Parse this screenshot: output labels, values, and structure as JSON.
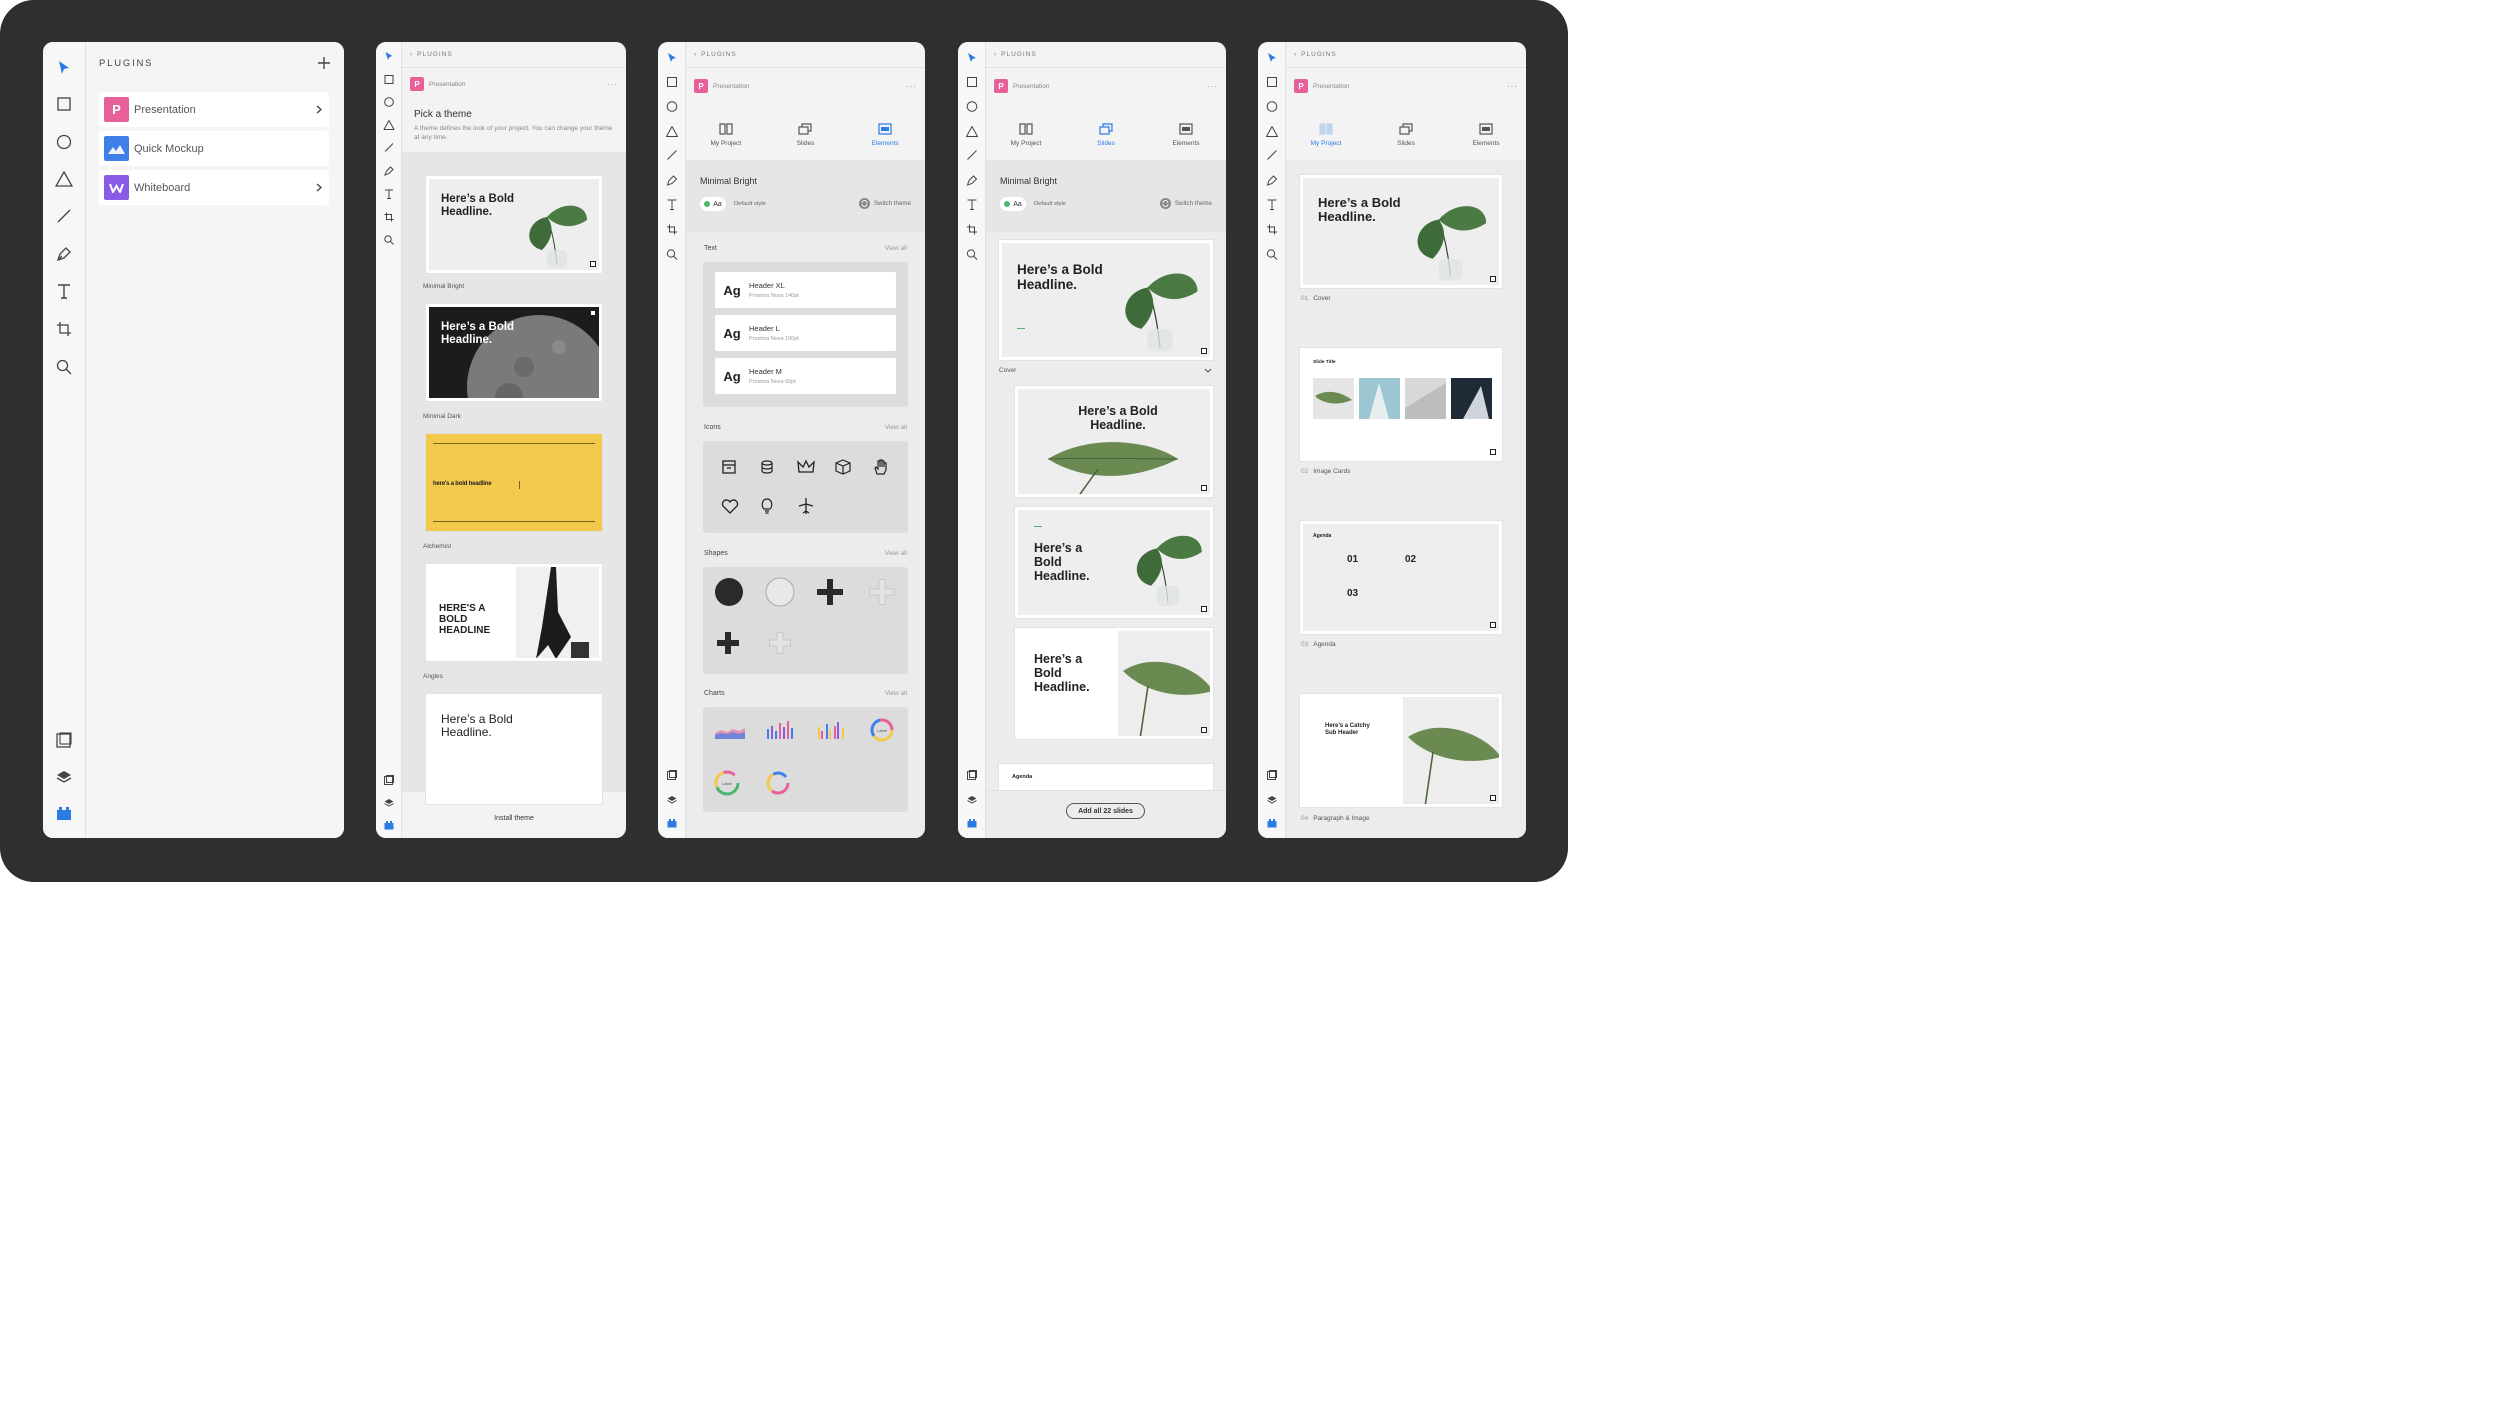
{
  "colors": {
    "background": "#2f2f2f",
    "accent": "#2a7be4",
    "presentation": "#e8609a",
    "mockup": "#3f7fe8",
    "whiteboard": "#8a5ce6",
    "yellow": "#f2c94c"
  },
  "panel1": {
    "title": "PLUGINS",
    "add_icon": "plus-icon",
    "plugins": [
      {
        "label": "Presentation",
        "icon": "presentation-logo",
        "has_chevron": true
      },
      {
        "label": "Quick Mockup",
        "icon": "mockup-logo",
        "has_chevron": false
      },
      {
        "label": "Whiteboard",
        "icon": "whiteboard-logo",
        "has_chevron": true
      }
    ]
  },
  "common": {
    "crumb": "PLUGINS",
    "plugin_name": "Presentation",
    "more": "···"
  },
  "panel2": {
    "heading": "Pick a theme",
    "description": "A theme defines the look of your project. You can change your theme at any time.",
    "themes": [
      {
        "name": "Minimal Bright",
        "headline": "Here’s a Bold Headline."
      },
      {
        "name": "Minimal Dark",
        "headline": "Here’s a Bold Headline."
      },
      {
        "name": "Alchemist",
        "headline": "here's a bold headline"
      },
      {
        "name": "Angles",
        "headline": "HERE'S A BOLD HEADLINE"
      },
      {
        "name": "",
        "headline": "Here’s a Bold Headline."
      }
    ],
    "install": "Install theme"
  },
  "tabs": {
    "project": "My Project",
    "slides": "Slides",
    "elements": "Elements"
  },
  "panel3": {
    "theme_name": "Minimal Bright",
    "style_badge": "Aa",
    "style_label": "Default style",
    "switch": "Switch theme",
    "view_all": "View all",
    "text_section": "Text",
    "type_styles": [
      {
        "ag": "Ag",
        "name": "Header XL",
        "spec": "Proxima Nova 140pt"
      },
      {
        "ag": "Ag",
        "name": "Header L",
        "spec": "Proxima Nova 100pt"
      },
      {
        "ag": "Ag",
        "name": "Header M",
        "spec": "Proxima Nova 60pt"
      }
    ],
    "icons_section": "Icons",
    "icons": [
      "archive-icon",
      "coins-icon",
      "crown-icon",
      "cube-icon",
      "hand-icon",
      "heart-icon",
      "bulb-icon",
      "plane-icon"
    ],
    "shapes_section": "Shapes",
    "charts_section": "Charts",
    "chart_label": "Label"
  },
  "panel4": {
    "theme_name": "Minimal Bright",
    "style_badge": "Aa",
    "style_label": "Default style",
    "switch": "Switch theme",
    "cover_label": "Cover",
    "headline": "Here’s a Bold Headline.",
    "agenda": "Agenda",
    "add_all": "Add all 22 slides"
  },
  "panel5": {
    "slides": [
      {
        "num": "01",
        "name": "Cover",
        "headline": "Here’s a Bold Headline."
      },
      {
        "num": "02",
        "name": "Image Cards",
        "headline": "Slide Title"
      },
      {
        "num": "03",
        "name": "Agenda",
        "headline": "Agenda"
      },
      {
        "num": "04",
        "name": "Paragraph & Image",
        "headline": "Here’s a Catchy Sub Header"
      }
    ],
    "agenda_nums": [
      "01",
      "02",
      "03"
    ]
  }
}
